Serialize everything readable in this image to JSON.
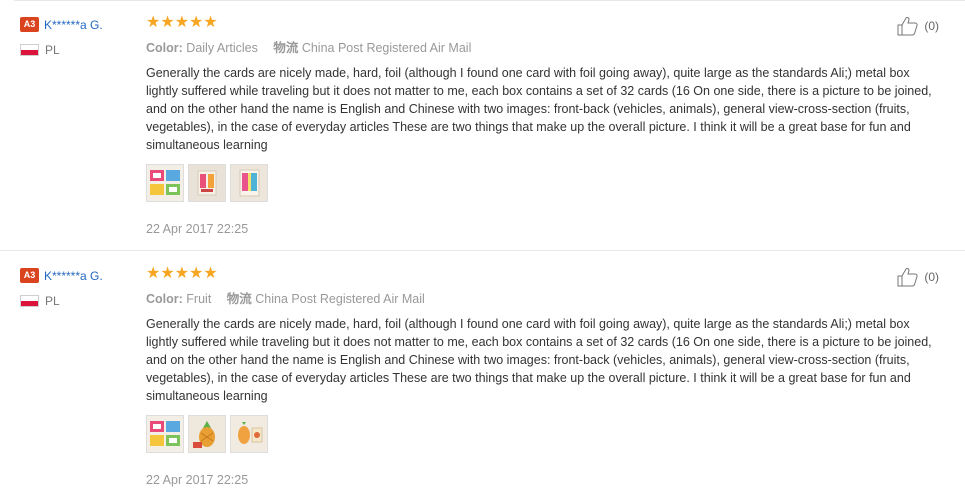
{
  "reviews": [
    {
      "badge": "A3",
      "username": "K******a G.",
      "country": "PL",
      "stars": "★★★★★",
      "color_label": "Color:",
      "color_value": "Daily Articles",
      "shipping_label": "物流",
      "shipping_value": "China Post Registered Air Mail",
      "text": "Generally the cards are nicely made, hard, foil (although I found one card with foil going away), quite large as the standards Ali;) metal box lightly suffered while traveling but it does not matter to me, each box contains a set of 32 cards (16 On one side, there is a picture to be joined, and on the other hand the name is English and Chinese with two images: front-back (vehicles, animals), general view-cross-section (fruits, vegetables), in the case of everyday articles These are two things that make up the overall picture. I think it will be a great base for fun and simultaneous learning",
      "date": "22 Apr 2017 22:25",
      "helpful_count": "(0)",
      "thumbnails": [
        "card-box-photo",
        "clothes-card-photo",
        "window-card-photo"
      ]
    },
    {
      "badge": "A3",
      "username": "K******a G.",
      "country": "PL",
      "stars": "★★★★★",
      "color_label": "Color:",
      "color_value": "Fruit",
      "shipping_label": "物流",
      "shipping_value": "China Post Registered Air Mail",
      "text": "Generally the cards are nicely made, hard, foil (although I found one card with foil going away), quite large as the standards Ali;) metal box lightly suffered while traveling but it does not matter to me, each box contains a set of 32 cards (16 On one side, there is a picture to be joined, and on the other hand the name is English and Chinese with two images: front-back (vehicles, animals), general view-cross-section (fruits, vegetables), in the case of everyday articles These are two things that make up the overall picture. I think it will be a great base for fun and simultaneous learning",
      "date": "22 Apr 2017 22:25",
      "helpful_count": "(0)",
      "thumbnails": [
        "card-box-photo",
        "pineapple-card-photo",
        "fruit-card-photo"
      ]
    }
  ],
  "colors": {
    "badge": "#d9441e",
    "username": "#2568c2",
    "star": "#f6a623",
    "muted": "#999999"
  }
}
